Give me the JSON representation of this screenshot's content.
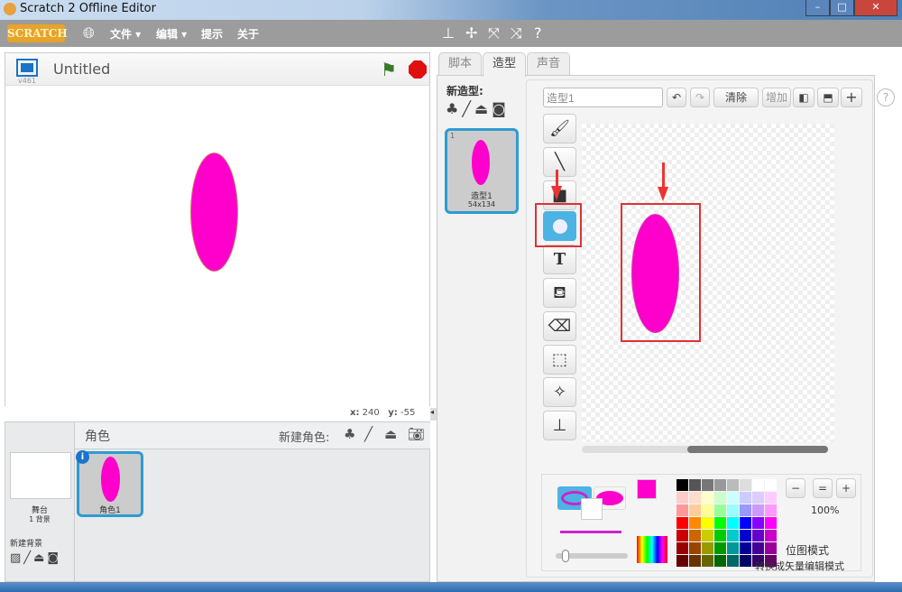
{
  "window": {
    "title": "Scratch 2 Offline Editor"
  },
  "menu": {
    "logo": "SCRATCH",
    "items": [
      {
        "label": "文件 ▾"
      },
      {
        "label": "编辑 ▾"
      },
      {
        "label": "提示"
      },
      {
        "label": "关于"
      }
    ]
  },
  "stage": {
    "title": "Untitled",
    "version": "v461",
    "x_label": "x:",
    "x_value": "240",
    "y_label": "y:",
    "y_value": "-55"
  },
  "sprites": {
    "header": "角色",
    "new_sprite_label": "新建角色:",
    "stage_label": "舞台",
    "backdrop_count": "1 背景",
    "new_backdrop_label": "新建背景",
    "items": [
      {
        "name": "角色1"
      }
    ]
  },
  "tabs": [
    {
      "label": "脚本"
    },
    {
      "label": "造型",
      "active": true
    },
    {
      "label": "声音"
    }
  ],
  "costumes": {
    "new_costume_label": "新造型:",
    "items": [
      {
        "index": "1",
        "name": "造型1",
        "size": "54x134"
      }
    ]
  },
  "paint_editor": {
    "costume_name": "造型1",
    "clear_label": "清除",
    "add_label": "增加",
    "zoom_level": "100%",
    "mode_label": "位图模式",
    "convert_label": "转换成矢量编辑模式",
    "selected_tool": "ellipse"
  },
  "colors": {
    "shape_fill": "#ff00cc",
    "accent": "#4db3e3",
    "annotation": "#dd3333"
  }
}
